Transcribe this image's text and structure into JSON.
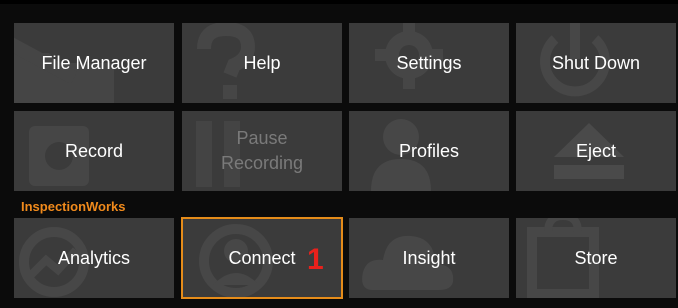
{
  "tiles": {
    "file_manager": "File Manager",
    "help": "Help",
    "settings": "Settings",
    "shut_down": "Shut Down",
    "record": "Record",
    "pause_recording": "Pause\nRecording",
    "profiles": "Profiles",
    "eject": "Eject",
    "analytics": "Analytics",
    "connect": "Connect",
    "insight": "Insight",
    "store": "Store"
  },
  "section_label": "InspectionWorks",
  "badge": "1",
  "colors": {
    "tile_bg": "#3b3b3b",
    "accent": "#e58c1a",
    "badge": "#e8211c"
  },
  "icons": {
    "file_manager": "folder-icon",
    "help": "question-icon",
    "settings": "gear-icon",
    "shut_down": "power-icon",
    "record": "record-icon",
    "pause_recording": "pause-icon",
    "profiles": "person-icon",
    "eject": "eject-icon",
    "analytics": "chart-icon",
    "connect": "connect-icon",
    "insight": "cloud-icon",
    "store": "bag-icon"
  }
}
